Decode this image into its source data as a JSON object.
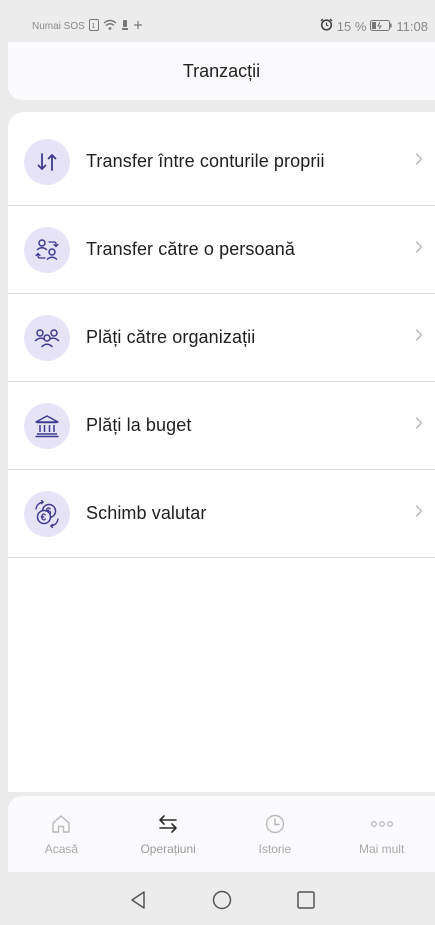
{
  "status_bar": {
    "carrier": "Numai SOS",
    "battery": "15 %",
    "time": "11:08"
  },
  "header": {
    "title": "Tranzacții"
  },
  "items": [
    {
      "label": "Transfer între conturile proprii",
      "icon": "arrows-up-down-icon"
    },
    {
      "label": "Transfer către o persoană",
      "icon": "person-transfer-icon"
    },
    {
      "label": "Plăți către organizații",
      "icon": "group-icon"
    },
    {
      "label": "Plăți la buget",
      "icon": "bank-icon"
    },
    {
      "label": "Schimb valutar",
      "icon": "currency-exchange-icon"
    }
  ],
  "bottom_nav": [
    {
      "label": "Acasă",
      "icon": "home-icon",
      "active": false
    },
    {
      "label": "Operațiuni",
      "icon": "operations-icon",
      "active": true
    },
    {
      "label": "Istorie",
      "icon": "clock-icon",
      "active": false
    },
    {
      "label": "Mai mult",
      "icon": "more-icon",
      "active": false
    }
  ],
  "colors": {
    "accent": "#3d3a8f",
    "icon_bg": "#e7e3f6",
    "page_bg": "#ececec"
  }
}
